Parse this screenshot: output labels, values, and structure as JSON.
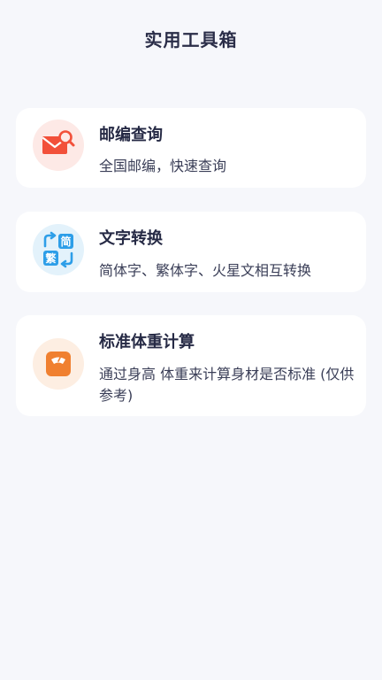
{
  "header": {
    "title": "实用工具箱"
  },
  "tools": [
    {
      "title": "邮编查询",
      "description": "全国邮编，快速查询",
      "icon": "mail-search-icon",
      "accent": "#f2503a"
    },
    {
      "title": "文字转换",
      "description": "简体字、繁体字、火星文相互转换",
      "icon": "text-convert-icon",
      "accent": "#2d9ee8",
      "icon_chars": [
        "简",
        "繁"
      ]
    },
    {
      "title": "标准体重计算",
      "description": "通过身高 体重来计算身材是否标准 (仅供参考)",
      "icon": "scale-icon",
      "accent": "#f08030"
    }
  ],
  "colors": {
    "background": "#f6f7fb",
    "card": "#ffffff",
    "title_text": "#2a2d48"
  }
}
